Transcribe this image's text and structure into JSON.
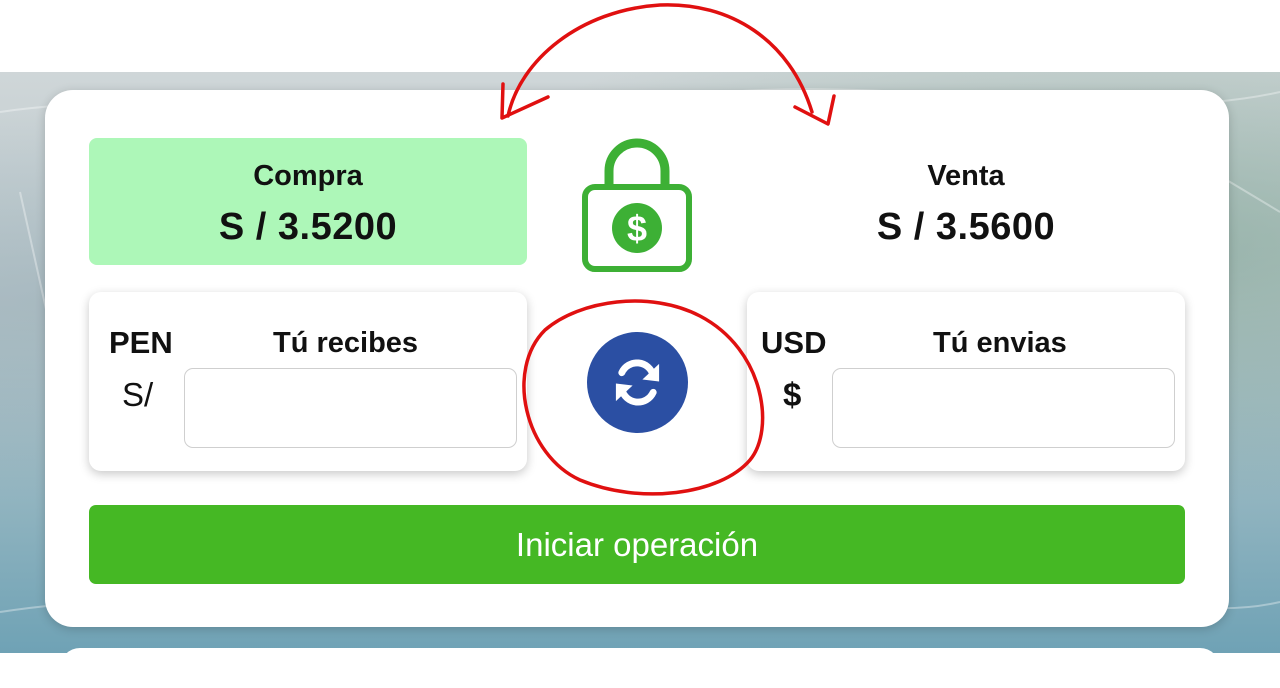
{
  "rates": {
    "compra": {
      "label": "Compra",
      "value": "S / 3.5200"
    },
    "venta": {
      "label": "Venta",
      "value": "S / 3.5600"
    }
  },
  "receive": {
    "currency_code": "PEN",
    "currency_symbol": "S/",
    "title": "Tú recibes",
    "input_value": "",
    "placeholder": ""
  },
  "send": {
    "currency_code": "USD",
    "currency_symbol": "$",
    "title": "Tú envias",
    "input_value": "",
    "placeholder": ""
  },
  "actions": {
    "start_label": "Iniciar operación",
    "swap_icon": "refresh-icon"
  },
  "icons": {
    "lock": "lock-dollar-icon",
    "swap": "refresh-icon"
  },
  "colors": {
    "compra_highlight": "#adf7b8",
    "primary_green": "#45b824",
    "lock_green": "#3db035",
    "swap_blue": "#2b4fa3",
    "annotation_red": "#e01010"
  }
}
